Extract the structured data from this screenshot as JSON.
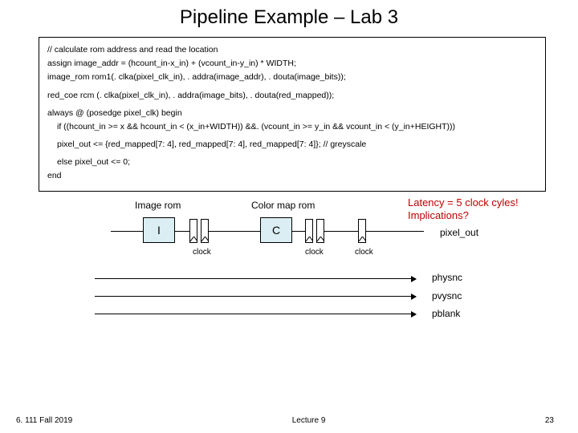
{
  "title": "Pipeline Example – Lab 3",
  "code": {
    "l1": "// calculate rom address and read the location",
    "l2": "assign image_addr = (hcount_in-x_in) + (vcount_in-y_in) * WIDTH;",
    "l3": "image_rom  rom1(. clka(pixel_clk_in), . addra(image_addr), . douta(image_bits));",
    "l4": "red_coe rcm (. clka(pixel_clk_in), . addra(image_bits), . douta(red_mapped));",
    "l5": "always @ (posedge pixel_clk) begin",
    "l6": "if ((hcount_in >= x && hcount_in < (x_in+WIDTH)) &&. (vcount_in >= y_in && vcount_in < (y_in+HEIGHT)))",
    "l7": "pixel_out <= {red_mapped[7: 4], red_mapped[7: 4], red_mapped[7: 4]}; // greyscale",
    "l8": "else pixel_out <= 0;",
    "l9": "end"
  },
  "diagram": {
    "imagerom": "Image rom",
    "colorrom": "Color  map rom",
    "latency1": "Latency = 5 clock cyles!",
    "latency2": "Implications?",
    "pixelout": "pixel_out",
    "box_i": "I",
    "box_c": "C",
    "clock": "clock",
    "physnc": "physnc",
    "pvysnc": "pvysnc",
    "pblank": "pblank"
  },
  "footer": {
    "left": "6. 111 Fall 2019",
    "center": "Lecture 9",
    "right": "23"
  }
}
